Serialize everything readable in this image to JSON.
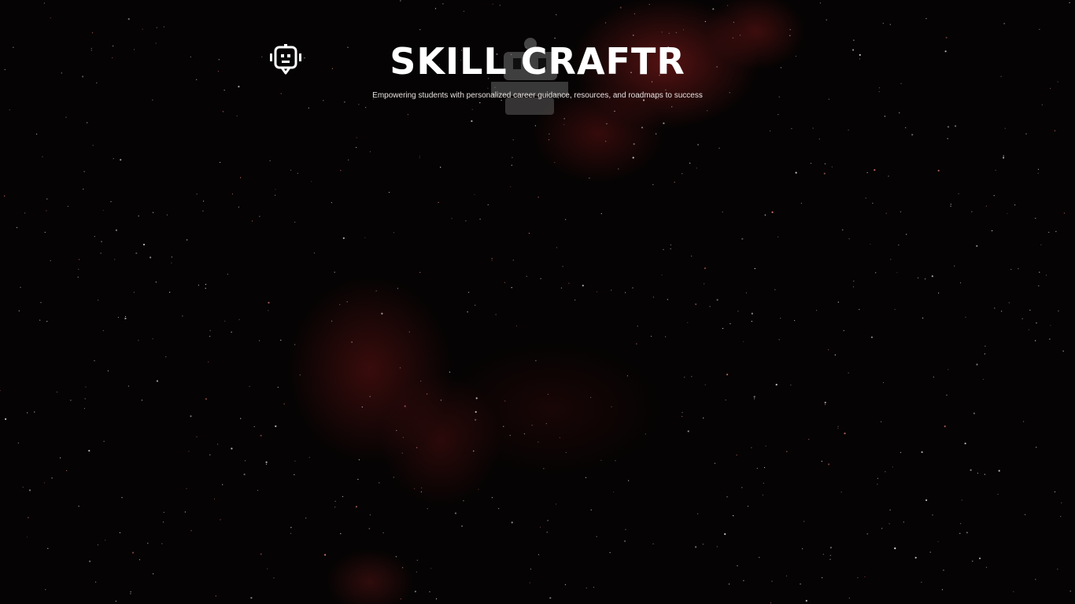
{
  "header": {
    "brand_title": "SKILL CRAFTR",
    "tagline": "Empowering students with personalized career guidance, resources, and roadmaps to success",
    "bot_icon": "chatbot-icon"
  },
  "colors": {
    "background": "#050303",
    "nebula": "#8c1c1c",
    "text": "#ffffff"
  }
}
